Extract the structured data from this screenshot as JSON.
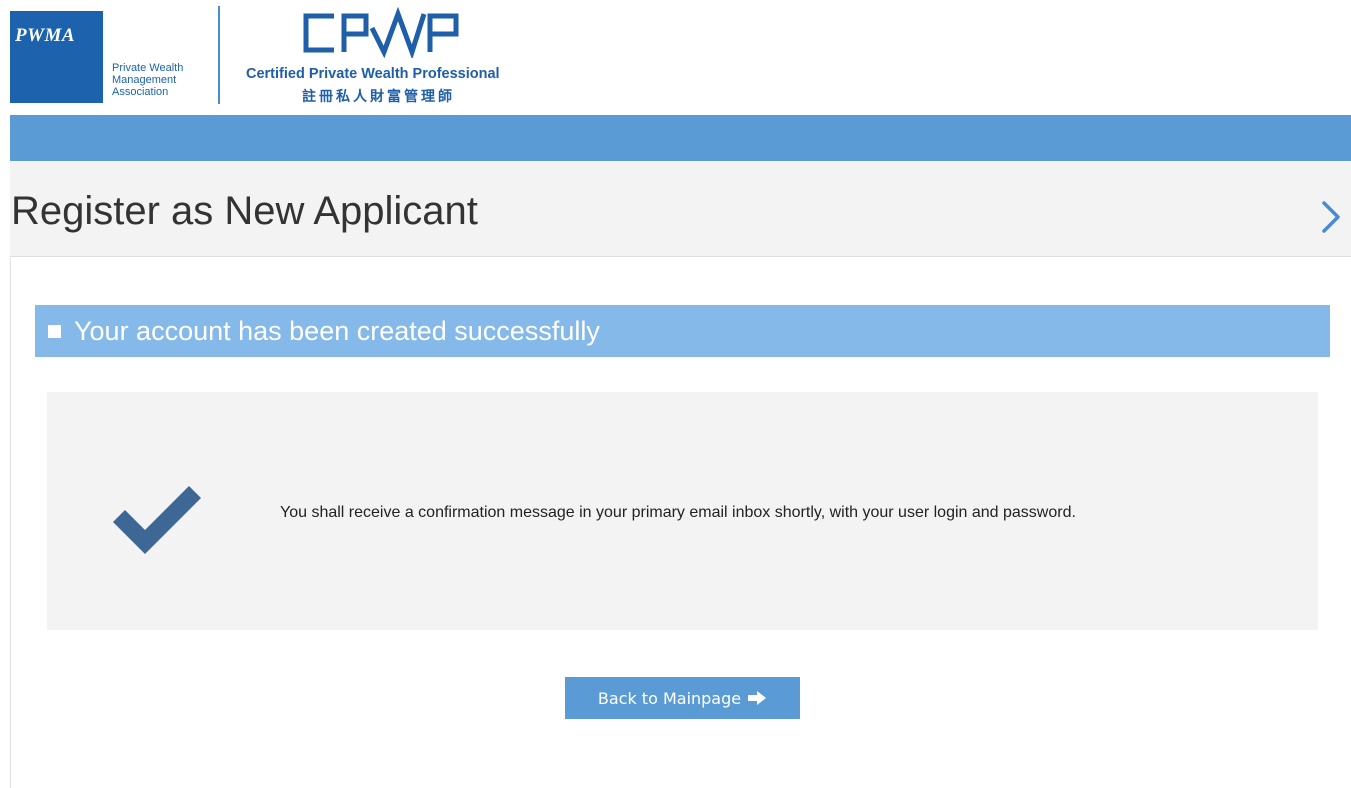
{
  "header": {
    "pwma_logo_text": "PWMA",
    "pwma_org_name": "Private Wealth\nManagement\nAssociation",
    "cpwp_logo_text": "CPWP",
    "cpwp_title": "Certified Private Wealth Professional",
    "cpwp_chinese": "註冊私人財富管理師",
    "brand_color": "#1c62ad"
  },
  "nav": {
    "band_color": "#5b9bd5"
  },
  "page": {
    "title": "Register as New Applicant",
    "next_icon": "chevron-right-icon"
  },
  "main": {
    "banner_text": "Your account has been created successfully",
    "banner_color": "#85b9e9",
    "status_icon": "checkmark-icon",
    "message": "You shall receive a confirmation message in your primary email inbox shortly, with your user login and password.",
    "back_button_label": "Back to Mainpage",
    "back_button_icon": "arrow-right-icon"
  }
}
